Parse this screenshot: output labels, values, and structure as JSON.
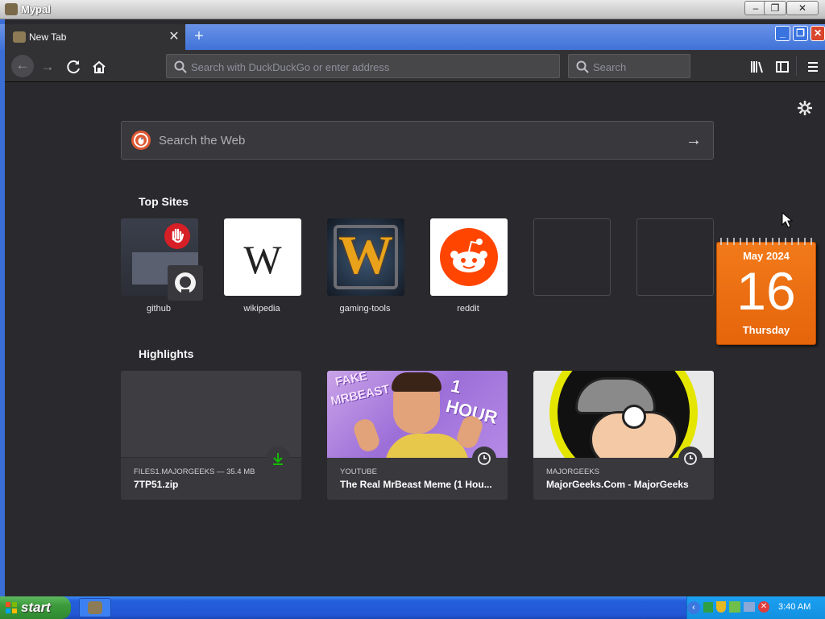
{
  "window": {
    "title": "Mypal"
  },
  "tab": {
    "title": "New Tab"
  },
  "navbar": {
    "url_placeholder": "Search with DuckDuckGo or enter address",
    "search_placeholder": "Search"
  },
  "newtab": {
    "search_placeholder": "Search the Web",
    "top_sites_title": "Top Sites",
    "top_sites": [
      {
        "label": "github"
      },
      {
        "label": "wikipedia"
      },
      {
        "label": "gaming-tools"
      },
      {
        "label": "reddit"
      }
    ],
    "highlights_title": "Highlights",
    "highlights": [
      {
        "source": "FILES1.MAJORGEEKS — 35.4 MB",
        "title": "7TP51.zip"
      },
      {
        "source": "YOUTUBE",
        "title": "The Real MrBeast Meme (1 Hou..."
      },
      {
        "source": "MAJORGEEKS",
        "title": "MajorGeeks.Com - MajorGeeks"
      }
    ],
    "thumb_text": {
      "wiki": "W",
      "wow": "W",
      "mrbeast_1": "FAKE",
      "mrbeast_2": "MRBEAST",
      "mrbeast_3": "1 HOUR"
    }
  },
  "calendar": {
    "month": "May 2024",
    "day": "16",
    "weekday": "Thursday"
  },
  "taskbar": {
    "start_label": "start",
    "clock": "3:40 AM"
  },
  "colors": {
    "accent": "#3a6ed6",
    "reddit": "#ff4500",
    "calendar": "#ef6d0f",
    "download": "#12bc00"
  }
}
